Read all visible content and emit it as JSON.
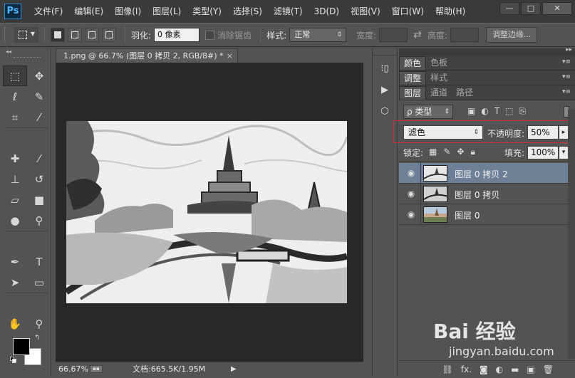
{
  "app": {
    "logo": "Ps"
  },
  "menu": [
    "文件(F)",
    "编辑(E)",
    "图像(I)",
    "图层(L)",
    "类型(Y)",
    "选择(S)",
    "滤镜(T)",
    "3D(D)",
    "视图(V)",
    "窗口(W)",
    "帮助(H)"
  ],
  "window_controls": {
    "minimize": "—",
    "restore": "□",
    "close": "✕"
  },
  "options": {
    "feather_label": "羽化:",
    "feather_value": "0 像素",
    "antialias_label": "消除锯齿",
    "style_label": "样式:",
    "style_value": "正常",
    "width_label": "宽度:",
    "height_label": "高度:",
    "refine_edge": "调整边缘..."
  },
  "document": {
    "tab_title": "1.png @ 66.7% (图层 0 拷贝 2, RGB/8#) *",
    "tab_close": "×",
    "zoom": "66.67%",
    "doc_info": "文档:665.5K/1.95M",
    "status_arrow": "▶"
  },
  "panels": {
    "tabs_row1": [
      "颜色",
      "色板"
    ],
    "tabs_row2": [
      "调整",
      "样式"
    ],
    "tabs_row3": [
      "图层",
      "通道",
      "路径"
    ],
    "kind_filter": "ρ 类型",
    "blend_mode": "滤色",
    "opacity_label": "不透明度:",
    "opacity_value": "50%",
    "lock_label": "锁定:",
    "fill_label": "填充:",
    "fill_value": "100%",
    "layers": [
      {
        "name": "图层 0 拷贝 2",
        "selected": true
      },
      {
        "name": "图层 0 拷贝",
        "selected": false
      },
      {
        "name": "图层 0",
        "selected": false
      }
    ],
    "bottom_icons": [
      "link-icon",
      "fx-icon",
      "mask-icon",
      "adjustment-icon",
      "folder-icon",
      "new-layer-icon",
      "trash-icon"
    ],
    "fx_text": "fx."
  },
  "watermark": {
    "logo": "Bai 经验",
    "url": "jingyan.baidu.com"
  },
  "colors": {
    "accent_selected_layer": "#6e7f98",
    "highlight_red": "#cf3131",
    "foreground": "#000000",
    "background": "#ffffff"
  }
}
